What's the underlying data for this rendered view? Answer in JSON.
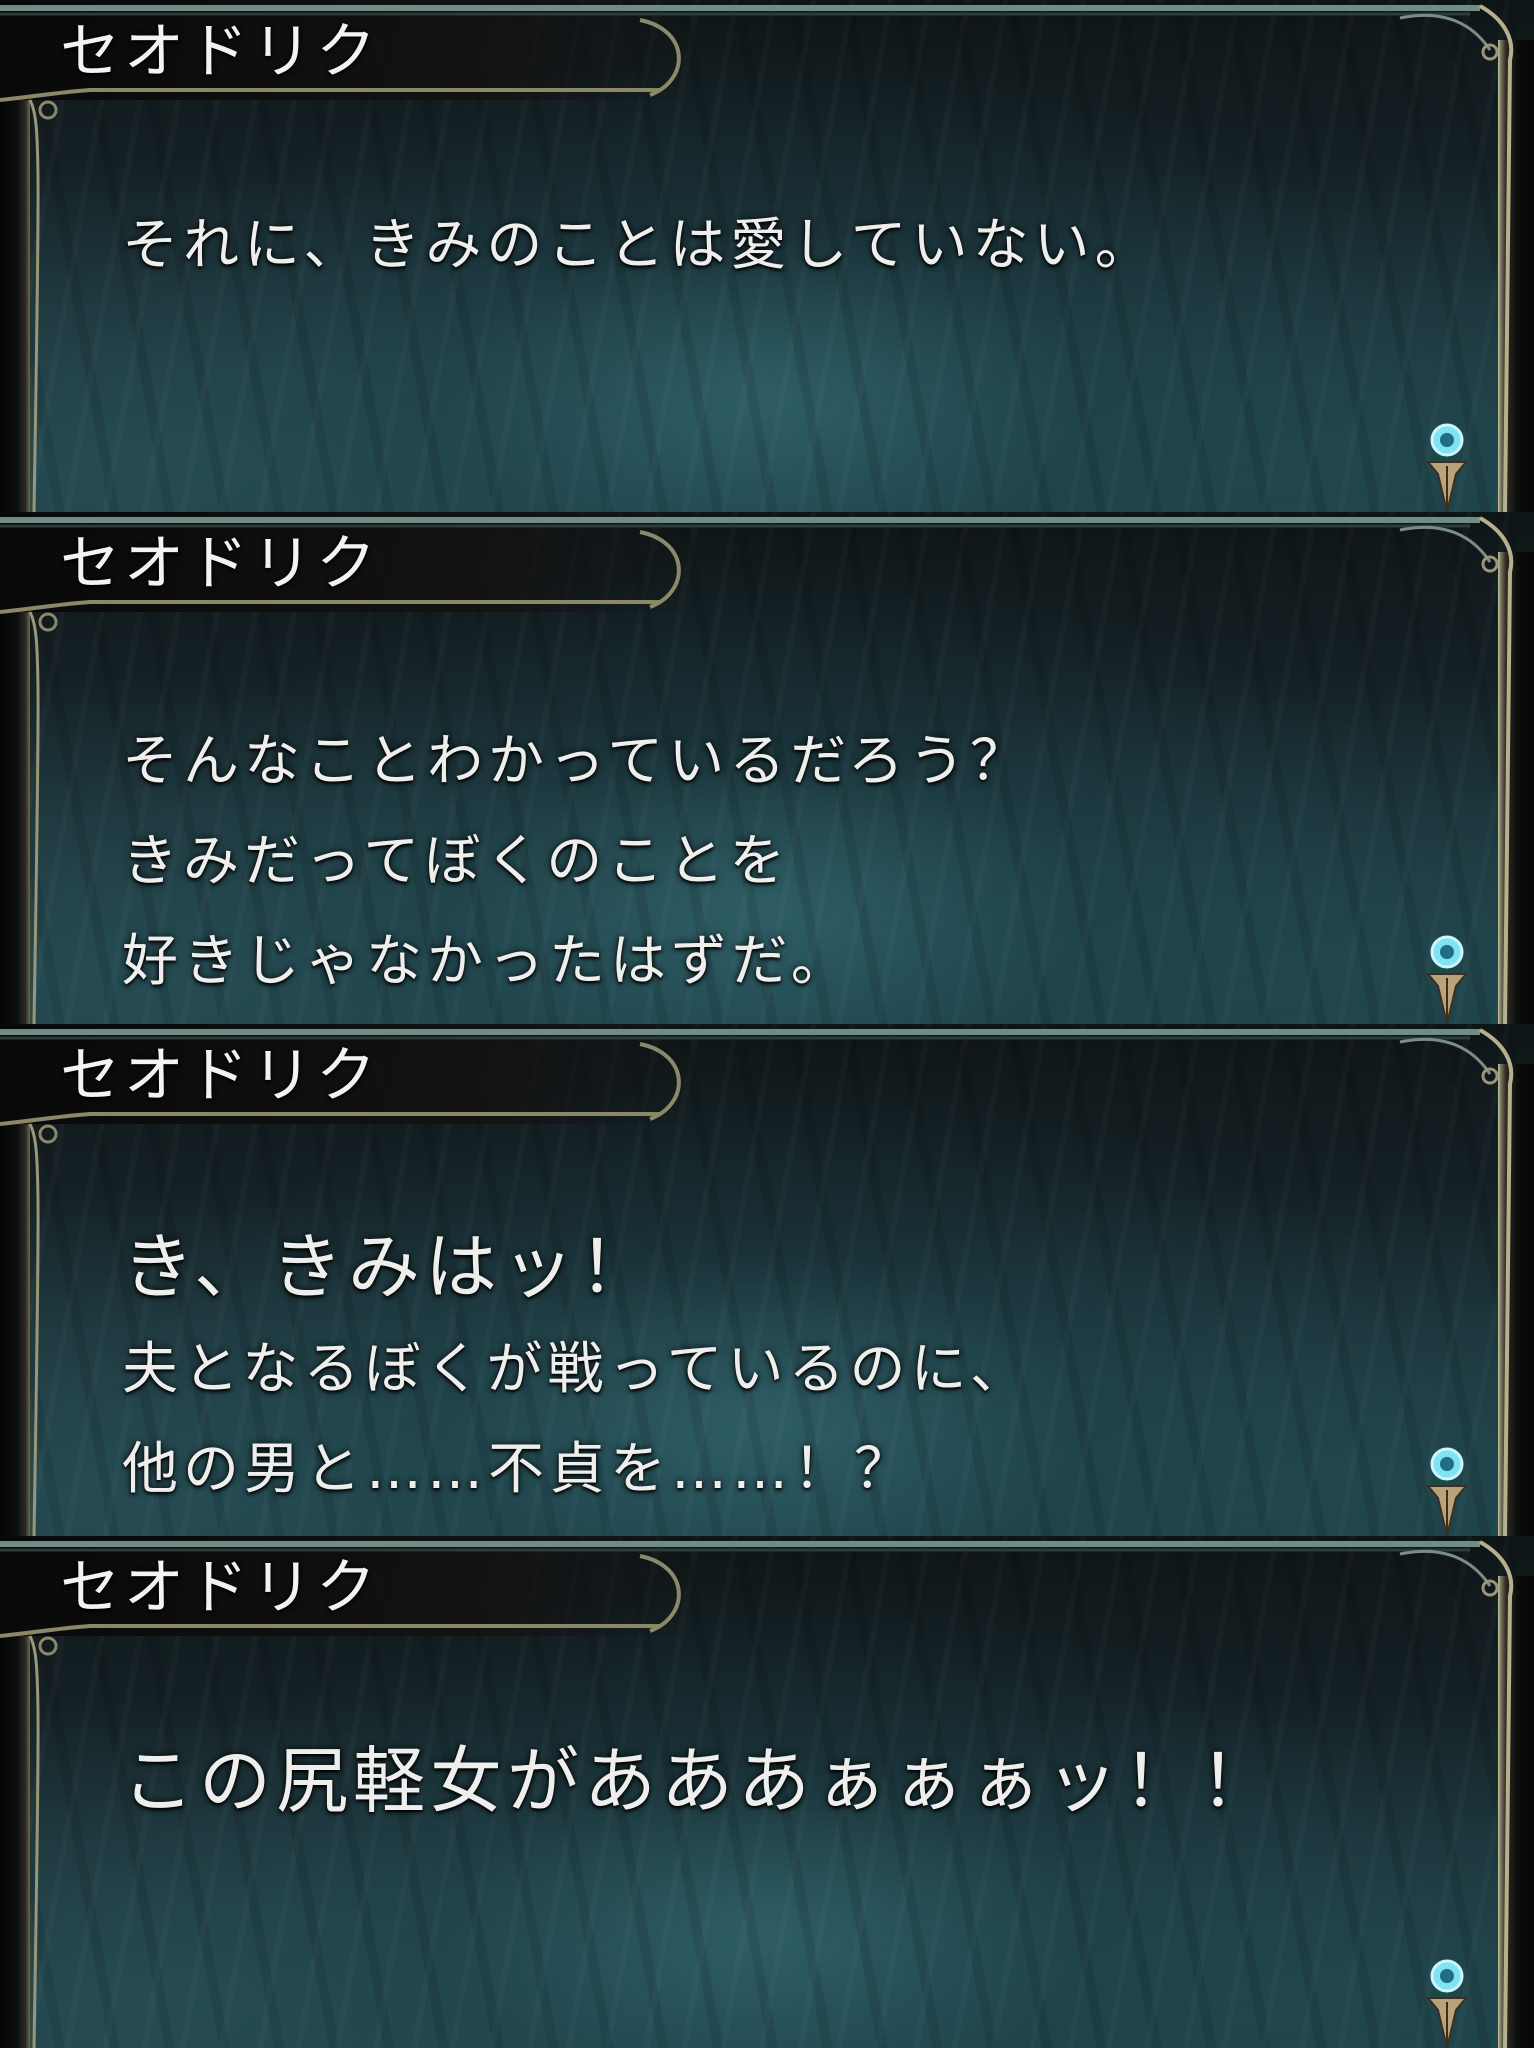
{
  "dialogue_log": [
    {
      "speaker": "セオドリク",
      "lines": [
        "それに、きみのことは愛していない。"
      ]
    },
    {
      "speaker": "セオドリク",
      "lines": [
        "そんなことわかっているだろう？",
        "きみだってぼくのことを",
        "好きじゃなかったはずだ。"
      ]
    },
    {
      "speaker": "セオドリク",
      "lines": [
        "き、きみはッ！",
        "夫となるぼくが戦っているのに、",
        "他の男と……不貞を……！？"
      ]
    },
    {
      "speaker": "セオドリク",
      "lines": [
        "この尻軽女があああぁぁぁッ！！"
      ]
    }
  ],
  "icons": {
    "advance_indicator": "blue-orb-quill-icon",
    "frame_ornament": "filigree-ornament-icon"
  },
  "colors": {
    "text": "#eeeeec",
    "panel_teal": "#1d3a40",
    "frame_gold": "#c9c19a",
    "orb_blue": "#7fe3f5"
  }
}
